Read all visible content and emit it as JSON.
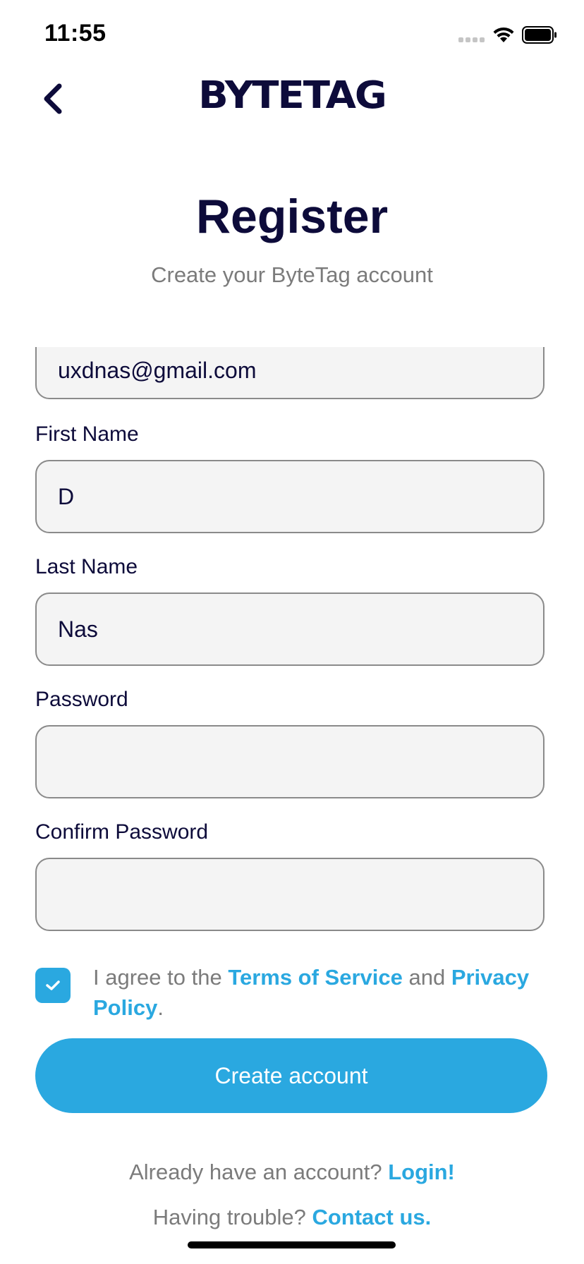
{
  "status_bar": {
    "time": "11:55"
  },
  "header": {
    "logo_text": "BYTETAG",
    "back_icon": "chevron-left-icon"
  },
  "page": {
    "title": "Register",
    "subtitle": "Create your ByteTag account"
  },
  "form": {
    "email": {
      "value": "uxdnas@gmail.com"
    },
    "first_name": {
      "label": "First Name",
      "value": "D"
    },
    "last_name": {
      "label": "Last Name",
      "value": "Nas"
    },
    "password": {
      "label": "Password",
      "value": ""
    },
    "confirm_password": {
      "label": "Confirm Password",
      "value": ""
    }
  },
  "agreement": {
    "checked": true,
    "prefix": "I agree to the ",
    "terms_link": "Terms of Service",
    "middle": " and ",
    "privacy_link": "Privacy Policy",
    "suffix": "."
  },
  "actions": {
    "create_account_label": "Create account"
  },
  "footer": {
    "login_prompt": "Already have an account? ",
    "login_link": "Login!",
    "trouble_prompt": "Having trouble? ",
    "contact_link": "Contact us."
  },
  "colors": {
    "accent": "#2aa8e0",
    "primary_text": "#0d0b3a",
    "muted_text": "#7b7b7b",
    "input_bg": "#f4f4f4"
  }
}
